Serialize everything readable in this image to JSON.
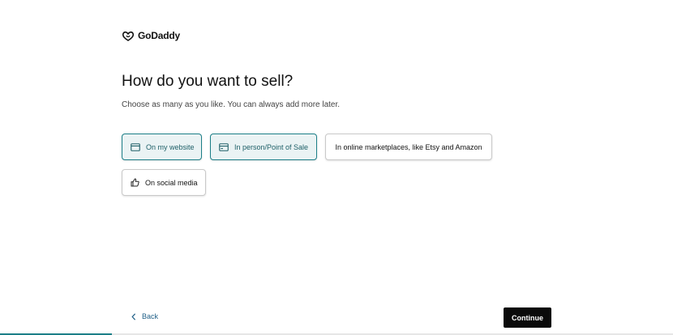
{
  "brand": {
    "name": "GoDaddy",
    "icon": "godaddy-logo-icon"
  },
  "page": {
    "title": "How do you want to sell?",
    "subtitle": "Choose as many as you like. You can always add more later."
  },
  "options": [
    {
      "label": "On my website",
      "icon": "browser-window-icon",
      "selected": true
    },
    {
      "label": "In person/Point of Sale",
      "icon": "credit-card-icon",
      "selected": true
    },
    {
      "label": "In online marketplaces, like Etsy and Amazon",
      "icon": "",
      "selected": false
    },
    {
      "label": "On social media",
      "icon": "thumbs-up-icon",
      "selected": false
    }
  ],
  "nav": {
    "back_label": "Back",
    "back_icon": "chevron-left-icon",
    "continue_label": "Continue"
  },
  "progress": {
    "fraction": 0.166
  },
  "colors": {
    "accent": "#1c7f88",
    "selected_bg": "#eaf3f4",
    "primary_button": "#0a0a0a",
    "link": "#1f5f87"
  }
}
